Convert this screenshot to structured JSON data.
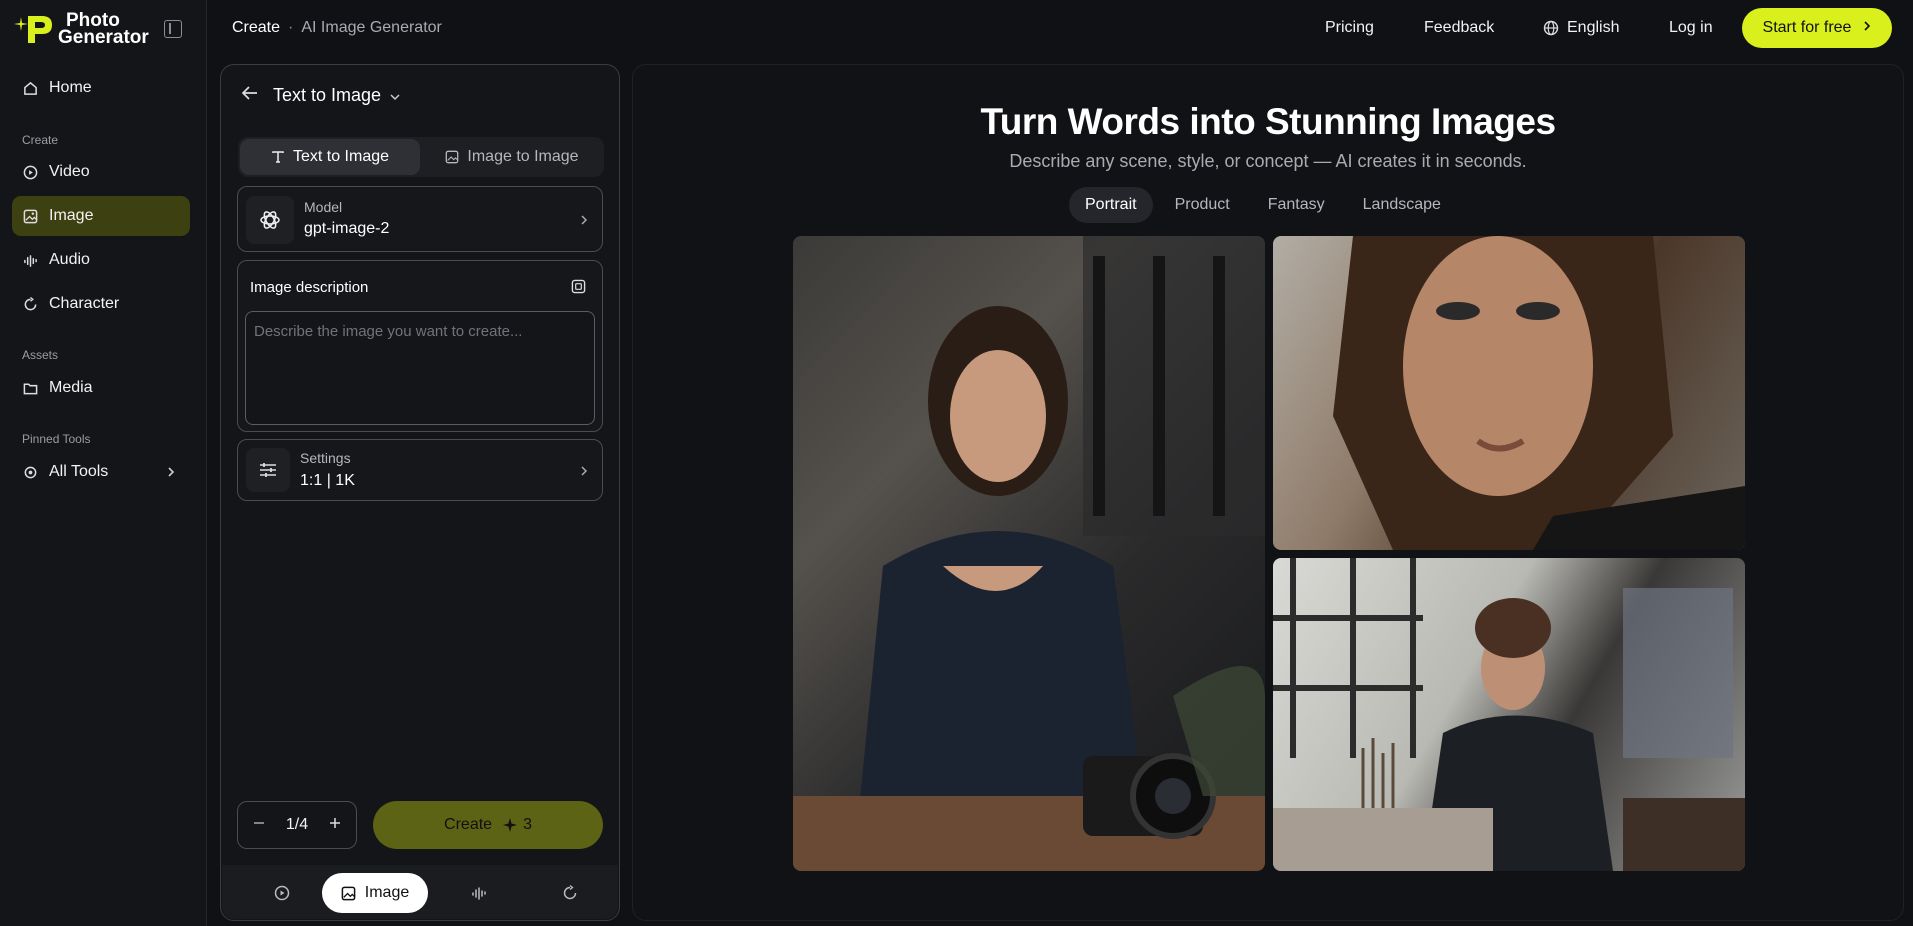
{
  "brand": {
    "line1": "Photo",
    "line2": "Generator",
    "accent_color": "#d9f01c"
  },
  "sidebar": {
    "home": "Home",
    "create_section": "Create",
    "create_items": [
      {
        "label": "Video",
        "icon": "video-icon"
      },
      {
        "label": "Image",
        "icon": "image-icon",
        "active": true
      },
      {
        "label": "Audio",
        "icon": "audio-icon"
      },
      {
        "label": "Character",
        "icon": "character-icon"
      }
    ],
    "assets_section": "Assets",
    "media": "Media",
    "pinned_section": "Pinned Tools",
    "all_tools": "All Tools"
  },
  "topbar": {
    "breadcrumb_root": "Create",
    "breadcrumb_separator": "·",
    "breadcrumb_current": "AI Image Generator",
    "pricing": "Pricing",
    "feedback": "Feedback",
    "language": "English",
    "login": "Log in",
    "start": "Start for free"
  },
  "panel": {
    "mode_title": "Text to Image",
    "tabs": [
      "Text to Image",
      "Image to Image"
    ],
    "model_label": "Model",
    "model_value": "gpt-image-2",
    "description_title": "Image description",
    "description_placeholder": "Describe the image you want to create...",
    "settings_label": "Settings",
    "settings_value": "1:1 | 1K",
    "count": "1/4",
    "create_label": "Create",
    "create_cost": "3",
    "bottom_image": "Image"
  },
  "showcase": {
    "title": "Turn Words into Stunning Images",
    "subtitle": "Describe any scene, style, or concept — AI creates it in seconds.",
    "tabs": [
      "Portrait",
      "Product",
      "Fantasy",
      "Landscape"
    ],
    "active_tab": "Portrait"
  }
}
